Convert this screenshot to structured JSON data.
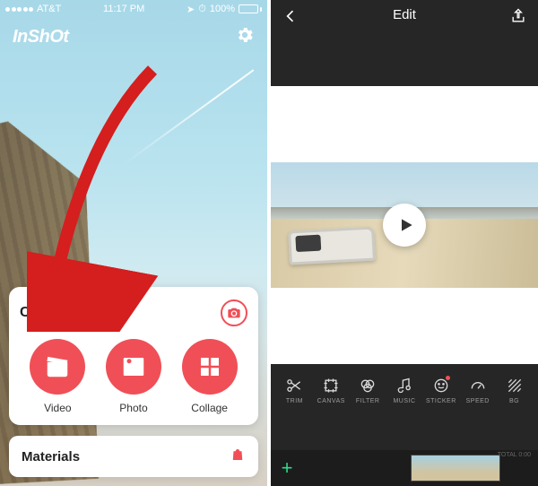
{
  "left": {
    "status": {
      "carrier": "AT&T",
      "time": "11:17 PM",
      "battery_pct": "100%"
    },
    "app_name": "InShOt",
    "create_card": {
      "title": "Create N",
      "options": [
        {
          "label": "Video"
        },
        {
          "label": "Photo"
        },
        {
          "label": "Collage"
        }
      ]
    },
    "materials": {
      "title": "Materials"
    }
  },
  "right": {
    "header": {
      "title": "Edit"
    },
    "tools": [
      {
        "label": "Trim"
      },
      {
        "label": "Canvas"
      },
      {
        "label": "Filter"
      },
      {
        "label": "Music"
      },
      {
        "label": "Sticker"
      },
      {
        "label": "Speed"
      },
      {
        "label": "BG"
      }
    ],
    "timeline_total": "TOTAL 0:00"
  }
}
